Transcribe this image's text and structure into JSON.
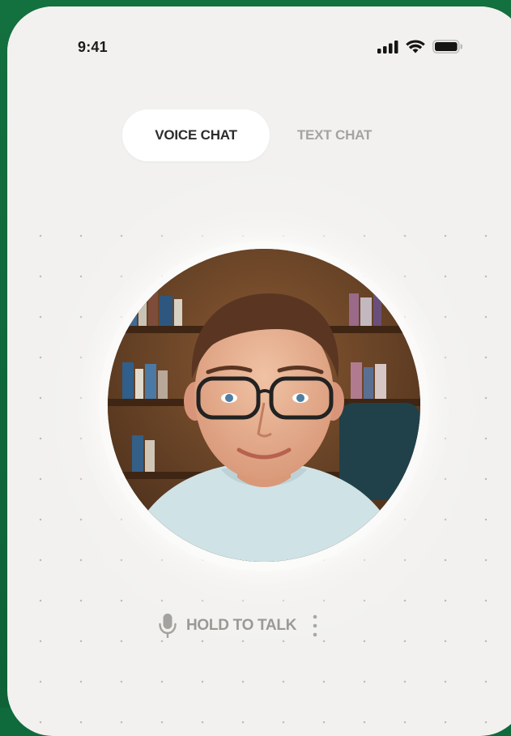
{
  "status_bar": {
    "time": "9:41",
    "icons": [
      "signal-icon",
      "wifi-icon",
      "battery-icon"
    ]
  },
  "tabs": [
    {
      "label": "VOICE CHAT",
      "active": true
    },
    {
      "label": "TEXT CHAT",
      "active": false
    }
  ],
  "avatar": {
    "description_icon": "person-photo"
  },
  "controls": {
    "hold_label": "HOLD TO TALK",
    "icons": [
      "microphone-icon",
      "more-vertical-icon"
    ]
  },
  "colors": {
    "background": "#0f6a3c",
    "screen": "#f2f1ef",
    "active_tab": "#ffffff",
    "inactive_text": "#a4a3a0",
    "dark_text": "#2c2c2c"
  }
}
